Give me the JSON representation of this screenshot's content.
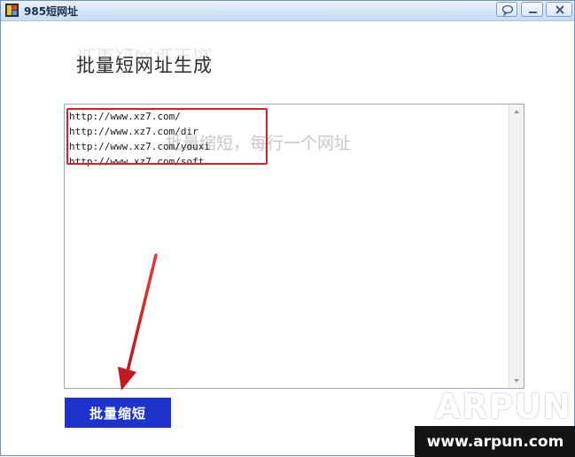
{
  "window": {
    "title": "985短网址",
    "controls": [
      "feedback-icon",
      "minimize-icon",
      "close-icon"
    ]
  },
  "main": {
    "heading": "批量短网址生成",
    "textarea": {
      "placeholder": "批量缩短，每行一个网址",
      "lines": [
        "http://www.xz7.com/",
        "http://www.xz7.com/dir",
        "http://www.xz7.com/youxi",
        "http://www.xz7.com/soft"
      ]
    },
    "shorten_button": "批量缩短"
  },
  "watermark": {
    "logo": "ARPUN",
    "url": "www.arpun.com"
  },
  "colors": {
    "button_bg": "#1d33cc",
    "annotation": "#d81f25",
    "titlebar": "#d5e5f7"
  }
}
